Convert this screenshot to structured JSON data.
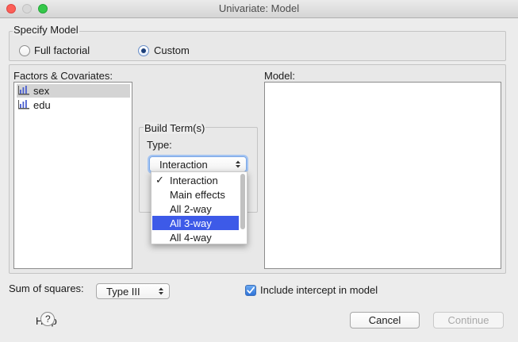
{
  "window": {
    "title": "Univariate: Model"
  },
  "specify_model": {
    "label": "Specify Model",
    "options": [
      {
        "label": "Full factorial",
        "checked": false
      },
      {
        "label": "Custom",
        "checked": true
      }
    ]
  },
  "factors": {
    "label": "Factors & Covariates:",
    "items": [
      {
        "label": "sex",
        "selected": true,
        "icon": "scale-variable-icon"
      },
      {
        "label": "edu",
        "selected": false,
        "icon": "scale-variable-icon"
      }
    ]
  },
  "model": {
    "label": "Model:"
  },
  "build_terms": {
    "label": "Build Term(s)",
    "type_label": "Type:",
    "selected": "Interaction",
    "options": [
      {
        "label": "Interaction",
        "checked": true,
        "highlighted": false
      },
      {
        "label": "Main effects",
        "checked": false,
        "highlighted": false
      },
      {
        "label": "All 2-way",
        "checked": false,
        "highlighted": false
      },
      {
        "label": "All 3-way",
        "checked": false,
        "highlighted": true
      },
      {
        "label": "All 4-way",
        "checked": false,
        "highlighted": false
      }
    ]
  },
  "sum_of_squares": {
    "label": "Sum of squares:",
    "value": "Type III"
  },
  "intercept": {
    "label": "Include intercept in model",
    "checked": true
  },
  "buttons": {
    "help": "Help",
    "cancel": "Cancel",
    "continue": "Continue"
  },
  "colors": {
    "highlight": "#3d5ae8",
    "checkbox": "#2f73d8"
  }
}
